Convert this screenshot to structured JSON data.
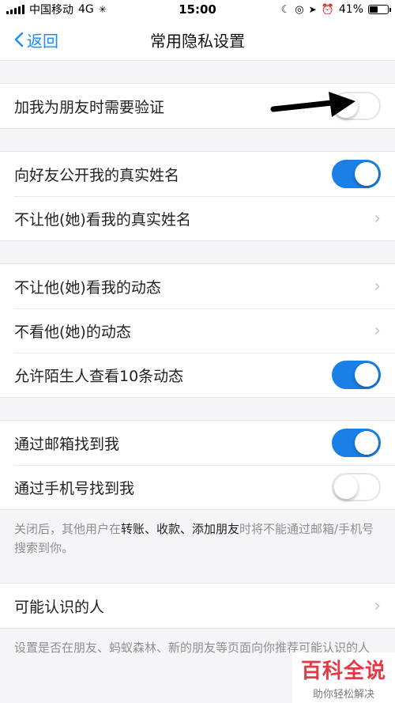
{
  "status_bar": {
    "carrier": "中国移动",
    "network": "4G",
    "time": "15:00",
    "battery": "41%",
    "battery_level": 0.41
  },
  "nav": {
    "back_label": "返回",
    "title": "常用隐私设置"
  },
  "groups": [
    {
      "rows": [
        {
          "label": "加我为朋友时需要验证",
          "control": "toggle",
          "on": false
        }
      ]
    },
    {
      "rows": [
        {
          "label": "向好友公开我的真实姓名",
          "control": "toggle",
          "on": true
        },
        {
          "label": "不让他(她)看我的真实姓名",
          "control": "chevron"
        }
      ]
    },
    {
      "rows": [
        {
          "label": "不让他(她)看我的动态",
          "control": "chevron"
        },
        {
          "label": "不看他(她)的动态",
          "control": "chevron"
        },
        {
          "label": "允许陌生人查看10条动态",
          "control": "toggle",
          "on": true
        }
      ]
    },
    {
      "rows": [
        {
          "label": "通过邮箱找到我",
          "control": "toggle",
          "on": true
        },
        {
          "label": "通过手机号找到我",
          "control": "toggle",
          "on": false
        }
      ],
      "note": {
        "part1": "关闭后，其他用户在",
        "bold": "转账、收款、添加朋友",
        "part2": "时将不能通过邮箱/手机号搜索到你。"
      }
    },
    {
      "rows": [
        {
          "label": "可能认识的人",
          "control": "chevron"
        }
      ],
      "note": {
        "text": "设置是否在朋友、蚂蚁森林、新的朋友等页面向你推荐可能认识的人"
      }
    }
  ],
  "watermark": {
    "title": "百科全说",
    "subtitle": "助你轻松解决"
  },
  "colors": {
    "accent": "#1a7fe6",
    "link": "#1a8cff",
    "background": "#f5f5f7"
  }
}
